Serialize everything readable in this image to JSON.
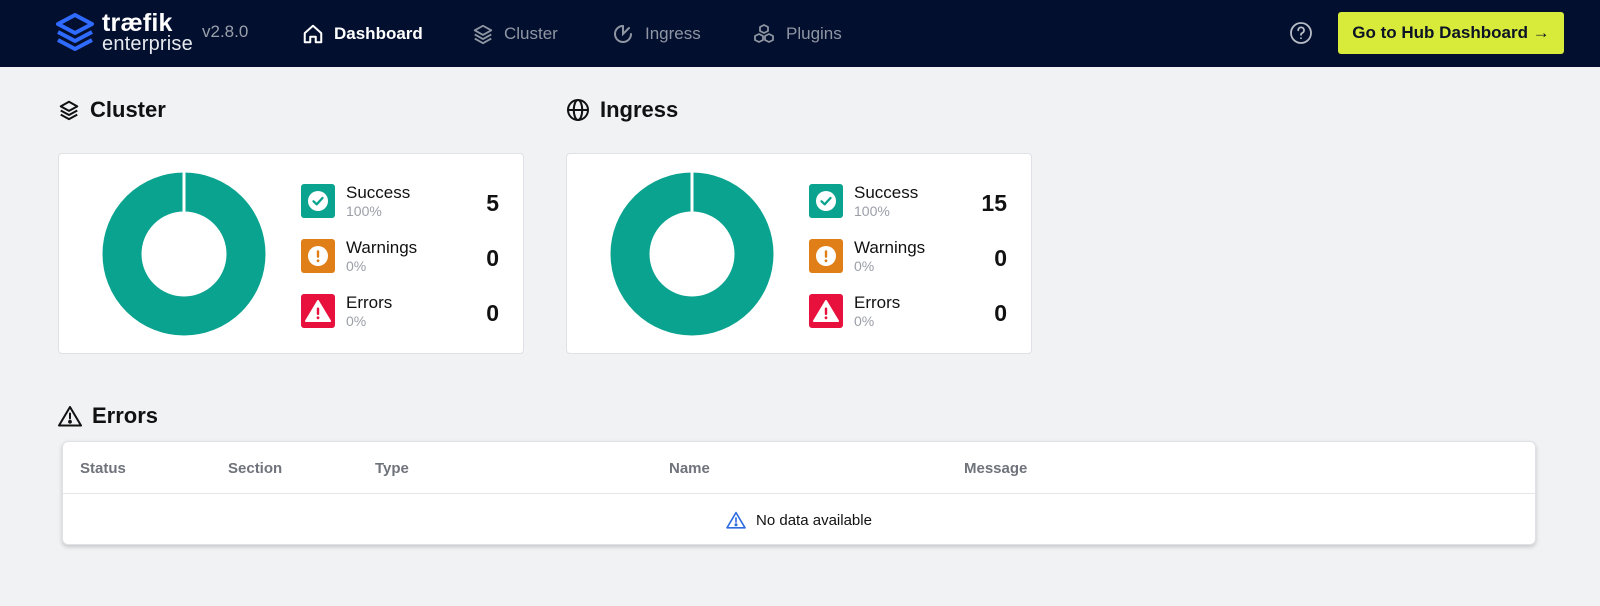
{
  "app": {
    "brand_name": "træfik",
    "brand_sub": "enterprise",
    "version": "v2.8.0"
  },
  "nav": {
    "dashboard": "Dashboard",
    "cluster": "Cluster",
    "ingress": "Ingress",
    "plugins": "Plugins"
  },
  "header": {
    "hub_button": "Go to Hub Dashboard →"
  },
  "colors": {
    "success": "#0aa38f",
    "warning": "#e07f17",
    "error": "#e8103c",
    "accent": "#d8ea3a",
    "topbar": "#030f2e"
  },
  "cluster": {
    "title": "Cluster",
    "success": {
      "label": "Success",
      "pct": "100%",
      "count": "5"
    },
    "warnings": {
      "label": "Warnings",
      "pct": "0%",
      "count": "0"
    },
    "errors": {
      "label": "Errors",
      "pct": "0%",
      "count": "0"
    }
  },
  "ingress": {
    "title": "Ingress",
    "success": {
      "label": "Success",
      "pct": "100%",
      "count": "15"
    },
    "warnings": {
      "label": "Warnings",
      "pct": "0%",
      "count": "0"
    },
    "errors": {
      "label": "Errors",
      "pct": "0%",
      "count": "0"
    }
  },
  "errors_section": {
    "title": "Errors",
    "columns": [
      "Status",
      "Section",
      "Type",
      "Name",
      "Message"
    ],
    "empty_text": "No data available"
  }
}
